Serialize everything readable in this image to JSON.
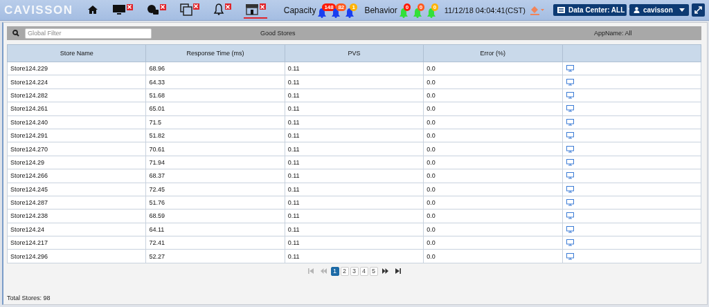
{
  "header": {
    "logo": "CAVISSON",
    "nav_icons": [
      {
        "kind": "home",
        "closable": false,
        "selected": false
      },
      {
        "kind": "monitor",
        "closable": true,
        "selected": false
      },
      {
        "kind": "lock",
        "closable": true,
        "selected": false
      },
      {
        "kind": "windows",
        "closable": true,
        "selected": false
      },
      {
        "kind": "bell",
        "closable": true,
        "selected": false
      },
      {
        "kind": "store",
        "closable": true,
        "selected": true
      }
    ],
    "capacity": {
      "label": "Capacity",
      "alerts": [
        {
          "count": "148",
          "color": "#ff1a00"
        },
        {
          "count": "82",
          "color": "#ff5a1f"
        },
        {
          "count": "1",
          "color": "#ffb300"
        }
      ]
    },
    "behavior": {
      "label": "Behavior",
      "alerts": [
        {
          "count": "0",
          "color": "#ff1a00"
        },
        {
          "count": "0",
          "color": "#ff5a1f"
        },
        {
          "count": "0",
          "color": "#ffb300"
        }
      ]
    },
    "datetime": "11/12/18 04:04:41(CST)",
    "data_center": "Data Center: ALL",
    "user": "cavisson"
  },
  "filter_bar": {
    "placeholder": "Global Filter",
    "title": "Good Stores",
    "app_name": "AppName: All"
  },
  "table": {
    "columns": [
      "Store Name",
      "Response Time (ms)",
      "PVS",
      "Error (%)"
    ],
    "rows": [
      [
        "Store124.229",
        "68.96",
        "0.11",
        "0.0"
      ],
      [
        "Store124.224",
        "64.33",
        "0.11",
        "0.0"
      ],
      [
        "Store124.282",
        "51.68",
        "0.11",
        "0.0"
      ],
      [
        "Store124.261",
        "65.01",
        "0.11",
        "0.0"
      ],
      [
        "Store124.240",
        "71.5",
        "0.11",
        "0.0"
      ],
      [
        "Store124.291",
        "51.82",
        "0.11",
        "0.0"
      ],
      [
        "Store124.270",
        "70.61",
        "0.11",
        "0.0"
      ],
      [
        "Store124.29",
        "71.94",
        "0.11",
        "0.0"
      ],
      [
        "Store124.266",
        "68.37",
        "0.11",
        "0.0"
      ],
      [
        "Store124.245",
        "72.45",
        "0.11",
        "0.0"
      ],
      [
        "Store124.287",
        "51.76",
        "0.11",
        "0.0"
      ],
      [
        "Store124.238",
        "68.59",
        "0.11",
        "0.0"
      ],
      [
        "Store124.24",
        "64.11",
        "0.11",
        "0.0"
      ],
      [
        "Store124.217",
        "72.41",
        "0.11",
        "0.0"
      ],
      [
        "Store124.296",
        "52.27",
        "0.11",
        "0.0"
      ]
    ]
  },
  "pagination": {
    "first_disabled": true,
    "prev_disabled": true,
    "pages": [
      {
        "label": "1",
        "selected": true
      },
      {
        "label": "2",
        "selected": false
      },
      {
        "label": "3",
        "selected": false
      },
      {
        "label": "4",
        "selected": false
      },
      {
        "label": "5",
        "selected": false
      }
    ]
  },
  "footer": "Total Stores: 98"
}
